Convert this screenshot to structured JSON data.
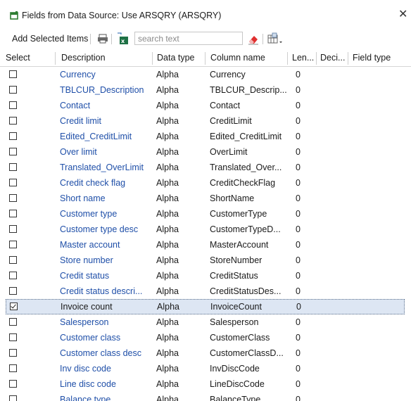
{
  "window": {
    "title": "Fields from Data Source: Use ARSQRY (ARSQRY)",
    "close_glyph": "✕"
  },
  "toolbar": {
    "add_selected_label": "Add Selected Items",
    "print_icon": "printer-icon",
    "export_icon": "excel-export-icon",
    "search_placeholder": "search text",
    "search_value": "",
    "clear_icon": "eraser-icon",
    "columns_icon": "column-chooser-icon"
  },
  "grid": {
    "columns": [
      "Select",
      "Description",
      "Data type",
      "Column name",
      "Len...",
      "Deci...",
      "Field type"
    ],
    "rows": [
      {
        "checked": false,
        "description": "Currency",
        "data_type": "Alpha",
        "column_name": "Currency",
        "length": "0"
      },
      {
        "checked": false,
        "description": "TBLCUR_Description",
        "data_type": "Alpha",
        "column_name": "TBLCUR_Descrip...",
        "length": "0"
      },
      {
        "checked": false,
        "description": "Contact",
        "data_type": "Alpha",
        "column_name": "Contact",
        "length": "0"
      },
      {
        "checked": false,
        "description": "Credit limit",
        "data_type": "Alpha",
        "column_name": "CreditLimit",
        "length": "0"
      },
      {
        "checked": false,
        "description": "Edited_CreditLimit",
        "data_type": "Alpha",
        "column_name": "Edited_CreditLimit",
        "length": "0"
      },
      {
        "checked": false,
        "description": "Over limit",
        "data_type": "Alpha",
        "column_name": "OverLimit",
        "length": "0"
      },
      {
        "checked": false,
        "description": "Translated_OverLimit",
        "data_type": "Alpha",
        "column_name": "Translated_Over...",
        "length": "0"
      },
      {
        "checked": false,
        "description": "Credit check flag",
        "data_type": "Alpha",
        "column_name": "CreditCheckFlag",
        "length": "0"
      },
      {
        "checked": false,
        "description": "Short name",
        "data_type": "Alpha",
        "column_name": "ShortName",
        "length": "0"
      },
      {
        "checked": false,
        "description": "Customer type",
        "data_type": "Alpha",
        "column_name": "CustomerType",
        "length": "0"
      },
      {
        "checked": false,
        "description": "Customer type desc",
        "data_type": "Alpha",
        "column_name": "CustomerTypeD...",
        "length": "0"
      },
      {
        "checked": false,
        "description": "Master account",
        "data_type": "Alpha",
        "column_name": "MasterAccount",
        "length": "0"
      },
      {
        "checked": false,
        "description": "Store number",
        "data_type": "Alpha",
        "column_name": "StoreNumber",
        "length": "0"
      },
      {
        "checked": false,
        "description": "Credit status",
        "data_type": "Alpha",
        "column_name": "CreditStatus",
        "length": "0"
      },
      {
        "checked": false,
        "description": "Credit status descri...",
        "data_type": "Alpha",
        "column_name": "CreditStatusDes...",
        "length": "0"
      },
      {
        "checked": true,
        "description": "Invoice count",
        "data_type": "Alpha",
        "column_name": "InvoiceCount",
        "length": "0",
        "selected": true
      },
      {
        "checked": false,
        "description": "Salesperson",
        "data_type": "Alpha",
        "column_name": "Salesperson",
        "length": "0"
      },
      {
        "checked": false,
        "description": "Customer class",
        "data_type": "Alpha",
        "column_name": "CustomerClass",
        "length": "0"
      },
      {
        "checked": false,
        "description": "Customer class desc",
        "data_type": "Alpha",
        "column_name": "CustomerClassD...",
        "length": "0"
      },
      {
        "checked": false,
        "description": "Inv disc code",
        "data_type": "Alpha",
        "column_name": "InvDiscCode",
        "length": "0"
      },
      {
        "checked": false,
        "description": "Line disc code",
        "data_type": "Alpha",
        "column_name": "LineDiscCode",
        "length": "0"
      },
      {
        "checked": false,
        "description": "Balance type",
        "data_type": "Alpha",
        "column_name": "BalanceType",
        "length": "0"
      }
    ]
  },
  "colors": {
    "link_text": "#1f4fa8",
    "selected_row_bg": "#dde6f3",
    "app_icon": "#2e7d32"
  }
}
